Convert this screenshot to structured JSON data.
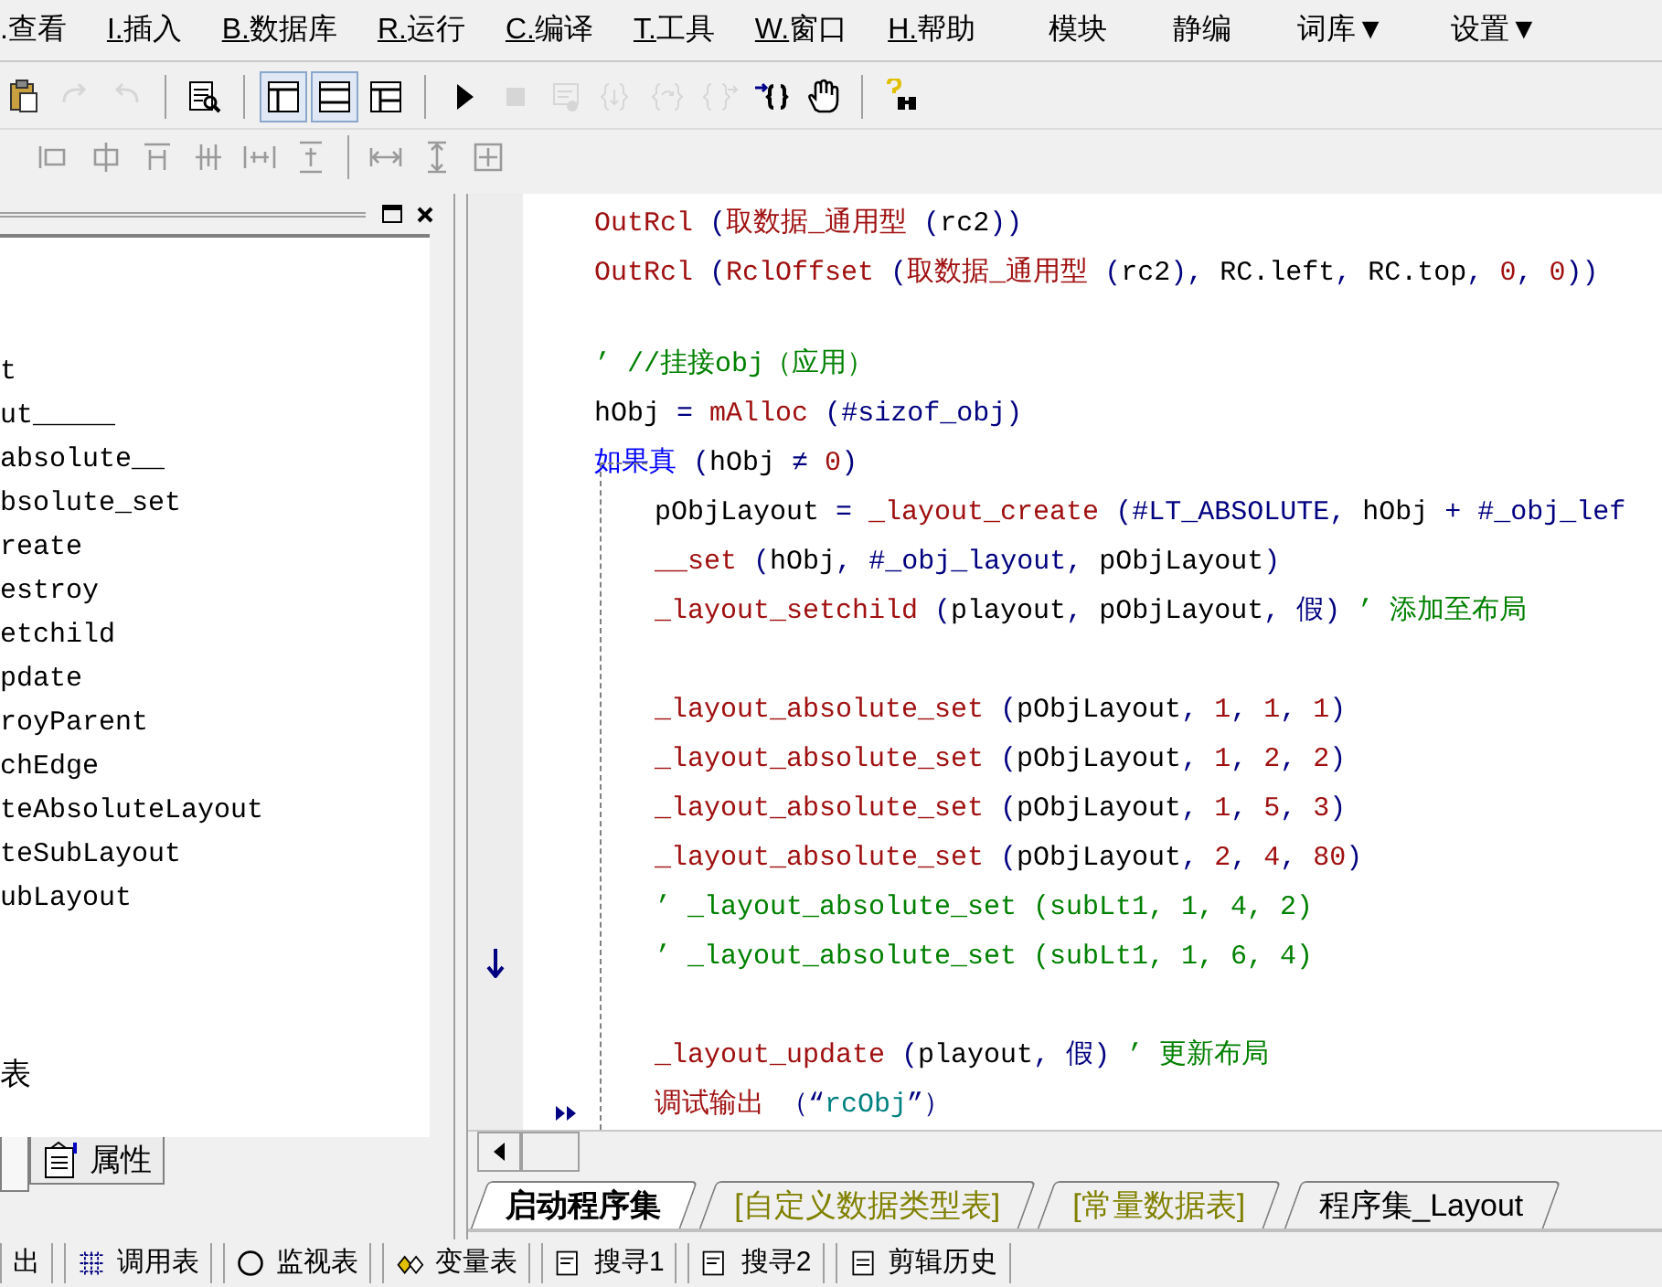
{
  "menu": [
    {
      "label": ".查看",
      "kind": "cut"
    },
    {
      "label": "I.插入",
      "kind": "mnemonic"
    },
    {
      "label": "B.数据库",
      "kind": "mnemonic"
    },
    {
      "label": "R.运行",
      "kind": "mnemonic"
    },
    {
      "label": "C.编译",
      "kind": "mnemonic"
    },
    {
      "label": "T.工具",
      "kind": "mnemonic"
    },
    {
      "label": "W.窗口",
      "kind": "mnemonic"
    },
    {
      "label": "H.帮助",
      "kind": "mnemonic"
    },
    {
      "label": "模块",
      "kind": "plain"
    },
    {
      "label": "静编",
      "kind": "plain"
    },
    {
      "label": "词库▼",
      "kind": "plain"
    },
    {
      "label": "设置▼",
      "kind": "plain"
    }
  ],
  "toolbar": [
    {
      "kind": "paste",
      "disabled": false
    },
    {
      "kind": "redo",
      "disabled": true
    },
    {
      "kind": "undo",
      "disabled": true
    },
    {
      "kind": "sep"
    },
    {
      "kind": "find",
      "disabled": false
    },
    {
      "kind": "sep"
    },
    {
      "kind": "layout1",
      "selected": true
    },
    {
      "kind": "layout2",
      "selected": true
    },
    {
      "kind": "layout3",
      "selected": false
    },
    {
      "kind": "sep"
    },
    {
      "kind": "run",
      "disabled": false
    },
    {
      "kind": "stop",
      "disabled": true
    },
    {
      "kind": "debug",
      "disabled": true
    },
    {
      "kind": "stepin",
      "disabled": true
    },
    {
      "kind": "stepover",
      "disabled": true
    },
    {
      "kind": "stepout",
      "disabled": true
    },
    {
      "kind": "runto",
      "disabled": false
    },
    {
      "kind": "hand",
      "disabled": false
    },
    {
      "kind": "sep"
    },
    {
      "kind": "help",
      "disabled": false
    }
  ],
  "left_panel": {
    "items": [
      {
        "text": "t"
      },
      {
        "text": "ut_____"
      },
      {
        "text": "absolute__"
      },
      {
        "text": "bsolute_set"
      },
      {
        "text": "reate"
      },
      {
        "text": "estroy"
      },
      {
        "text": "etchild"
      },
      {
        "text": "pdate"
      },
      {
        "text": "royParent"
      },
      {
        "text": "chEdge"
      },
      {
        "text": "teAbsoluteLayout"
      },
      {
        "text": "teSubLayout"
      },
      {
        "text": "ubLayout"
      }
    ],
    "footer_item": "表",
    "tabs": [
      {
        "selected": true
      },
      {
        "label": "属性",
        "selected": false
      }
    ]
  },
  "code_lines": [
    {
      "kind": "code",
      "segments": [
        {
          "kind": "func",
          "text": "OutRcl"
        },
        {
          "kind": "paren",
          "text": " ("
        },
        {
          "kind": "func",
          "text": "取数据_通用型"
        },
        {
          "kind": "paren",
          "text": " ("
        },
        {
          "kind": "plain",
          "text": "rc2"
        },
        {
          "kind": "paren",
          "text": "))"
        }
      ]
    },
    {
      "kind": "code",
      "segments": [
        {
          "kind": "func",
          "text": "OutRcl"
        },
        {
          "kind": "paren",
          "text": " ("
        },
        {
          "kind": "func",
          "text": "RclOffset"
        },
        {
          "kind": "paren",
          "text": " ("
        },
        {
          "kind": "func",
          "text": "取数据_通用型"
        },
        {
          "kind": "paren",
          "text": " ("
        },
        {
          "kind": "plain",
          "text": "rc2"
        },
        {
          "kind": "paren",
          "text": "), "
        },
        {
          "kind": "plain",
          "text": "RC.left"
        },
        {
          "kind": "paren",
          "text": ", "
        },
        {
          "kind": "plain",
          "text": "RC.top"
        },
        {
          "kind": "paren",
          "text": ", "
        },
        {
          "kind": "number",
          "text": "0"
        },
        {
          "kind": "paren",
          "text": ", "
        },
        {
          "kind": "number",
          "text": "0"
        },
        {
          "kind": "paren",
          "text": "))"
        }
      ]
    },
    {
      "kind": "blank"
    },
    {
      "kind": "code",
      "segments": [
        {
          "kind": "comment",
          "text": "’ //挂接obj（应用）"
        }
      ]
    },
    {
      "kind": "code",
      "segments": [
        {
          "kind": "plain",
          "text": "hObj"
        },
        {
          "kind": "paren",
          "text": " = "
        },
        {
          "kind": "func",
          "text": "mAlloc"
        },
        {
          "kind": "paren",
          "text": " ("
        },
        {
          "kind": "const",
          "text": "#sizof_obj"
        },
        {
          "kind": "paren",
          "text": ")"
        }
      ]
    },
    {
      "kind": "code",
      "segments": [
        {
          "kind": "keyword",
          "text": "如果真"
        },
        {
          "kind": "paren",
          "text": " ("
        },
        {
          "kind": "plain",
          "text": "hObj"
        },
        {
          "kind": "paren",
          "text": " ≠ "
        },
        {
          "kind": "number",
          "text": "0"
        },
        {
          "kind": "paren",
          "text": ")"
        }
      ],
      "children": [
        {
          "kind": "code",
          "segments": [
            {
              "kind": "plain",
              "text": "pObjLayout"
            },
            {
              "kind": "paren",
              "text": " = "
            },
            {
              "kind": "func",
              "text": "_layout_create"
            },
            {
              "kind": "paren",
              "text": " ("
            },
            {
              "kind": "const",
              "text": "#LT_ABSOLUTE"
            },
            {
              "kind": "paren",
              "text": ", "
            },
            {
              "kind": "plain",
              "text": "hObj"
            },
            {
              "kind": "paren",
              "text": " + "
            },
            {
              "kind": "const",
              "text": "#_obj_lef"
            }
          ]
        },
        {
          "kind": "code",
          "segments": [
            {
              "kind": "func",
              "text": "__set"
            },
            {
              "kind": "paren",
              "text": " ("
            },
            {
              "kind": "plain",
              "text": "hObj"
            },
            {
              "kind": "paren",
              "text": ", "
            },
            {
              "kind": "const",
              "text": "#_obj_layout"
            },
            {
              "kind": "paren",
              "text": ", "
            },
            {
              "kind": "plain",
              "text": "pObjLayout"
            },
            {
              "kind": "paren",
              "text": ")"
            }
          ]
        },
        {
          "kind": "code",
          "segments": [
            {
              "kind": "func",
              "text": "_layout_setchild"
            },
            {
              "kind": "paren",
              "text": " ("
            },
            {
              "kind": "plain",
              "text": "playout"
            },
            {
              "kind": "paren",
              "text": ", "
            },
            {
              "kind": "plain",
              "text": "pObjLayout"
            },
            {
              "kind": "paren",
              "text": ", "
            },
            {
              "kind": "const",
              "text": "假"
            },
            {
              "kind": "paren",
              "text": ") "
            },
            {
              "kind": "comment",
              "text": "’ 添加至布局"
            }
          ]
        },
        {
          "kind": "blank"
        },
        {
          "kind": "code",
          "segments": [
            {
              "kind": "func",
              "text": "_layout_absolute_set"
            },
            {
              "kind": "paren",
              "text": " ("
            },
            {
              "kind": "plain",
              "text": "pObjLayout"
            },
            {
              "kind": "paren",
              "text": ", "
            },
            {
              "kind": "number",
              "text": "1"
            },
            {
              "kind": "paren",
              "text": ", "
            },
            {
              "kind": "number",
              "text": "1"
            },
            {
              "kind": "paren",
              "text": ", "
            },
            {
              "kind": "number",
              "text": "1"
            },
            {
              "kind": "paren",
              "text": ")"
            }
          ]
        },
        {
          "kind": "code",
          "segments": [
            {
              "kind": "func",
              "text": "_layout_absolute_set"
            },
            {
              "kind": "paren",
              "text": " ("
            },
            {
              "kind": "plain",
              "text": "pObjLayout"
            },
            {
              "kind": "paren",
              "text": ", "
            },
            {
              "kind": "number",
              "text": "1"
            },
            {
              "kind": "paren",
              "text": ", "
            },
            {
              "kind": "number",
              "text": "2"
            },
            {
              "kind": "paren",
              "text": ", "
            },
            {
              "kind": "number",
              "text": "2"
            },
            {
              "kind": "paren",
              "text": ")"
            }
          ]
        },
        {
          "kind": "code",
          "segments": [
            {
              "kind": "func",
              "text": "_layout_absolute_set"
            },
            {
              "kind": "paren",
              "text": " ("
            },
            {
              "kind": "plain",
              "text": "pObjLayout"
            },
            {
              "kind": "paren",
              "text": ", "
            },
            {
              "kind": "number",
              "text": "1"
            },
            {
              "kind": "paren",
              "text": ", "
            },
            {
              "kind": "number",
              "text": "5"
            },
            {
              "kind": "paren",
              "text": ", "
            },
            {
              "kind": "number",
              "text": "3"
            },
            {
              "kind": "paren",
              "text": ")"
            }
          ]
        },
        {
          "kind": "code",
          "segments": [
            {
              "kind": "func",
              "text": "_layout_absolute_set"
            },
            {
              "kind": "paren",
              "text": " ("
            },
            {
              "kind": "plain",
              "text": "pObjLayout"
            },
            {
              "kind": "paren",
              "text": ", "
            },
            {
              "kind": "number",
              "text": "2"
            },
            {
              "kind": "paren",
              "text": ", "
            },
            {
              "kind": "number",
              "text": "4"
            },
            {
              "kind": "paren",
              "text": ", "
            },
            {
              "kind": "number",
              "text": "80"
            },
            {
              "kind": "paren",
              "text": ")"
            }
          ]
        },
        {
          "kind": "code",
          "segments": [
            {
              "kind": "comment",
              "text": "’ _layout_absolute_set (subLt1, 1, 4, 2)"
            }
          ]
        },
        {
          "kind": "code",
          "segments": [
            {
              "kind": "comment",
              "text": "’ _layout_absolute_set (subLt1, 1, 6, 4)"
            }
          ],
          "arrow_mark": true
        },
        {
          "kind": "blank"
        },
        {
          "kind": "code",
          "segments": [
            {
              "kind": "func",
              "text": "_layout_update"
            },
            {
              "kind": "paren",
              "text": " ("
            },
            {
              "kind": "plain",
              "text": "playout"
            },
            {
              "kind": "paren",
              "text": ", "
            },
            {
              "kind": "const",
              "text": "假"
            },
            {
              "kind": "paren",
              "text": ") "
            },
            {
              "kind": "comment",
              "text": "’ 更新布局"
            }
          ]
        },
        {
          "kind": "code",
          "segments": [
            {
              "kind": "func",
              "text": "调试输出"
            },
            {
              "kind": "paren",
              "text": " （“"
            },
            {
              "kind": "string",
              "text": "rcObj"
            },
            {
              "kind": "paren",
              "text": "”）"
            }
          ],
          "next_mark": true
        }
      ]
    }
  ],
  "editor_tabs": [
    {
      "label": "启动程序集",
      "kind": "program",
      "selected": true
    },
    {
      "label": "[自定义数据类型表]",
      "kind": "table",
      "selected": false
    },
    {
      "label": "[常量数据表]",
      "kind": "table",
      "selected": false
    },
    {
      "label": "程序集_Layout",
      "kind": "program",
      "selected": false
    }
  ],
  "bottom_tabs": [
    {
      "label": "出"
    },
    {
      "label": "调用表"
    },
    {
      "label": "监视表"
    },
    {
      "label": "变量表"
    },
    {
      "label": "搜寻1"
    },
    {
      "label": "搜寻2"
    },
    {
      "label": "剪辑历史"
    }
  ]
}
